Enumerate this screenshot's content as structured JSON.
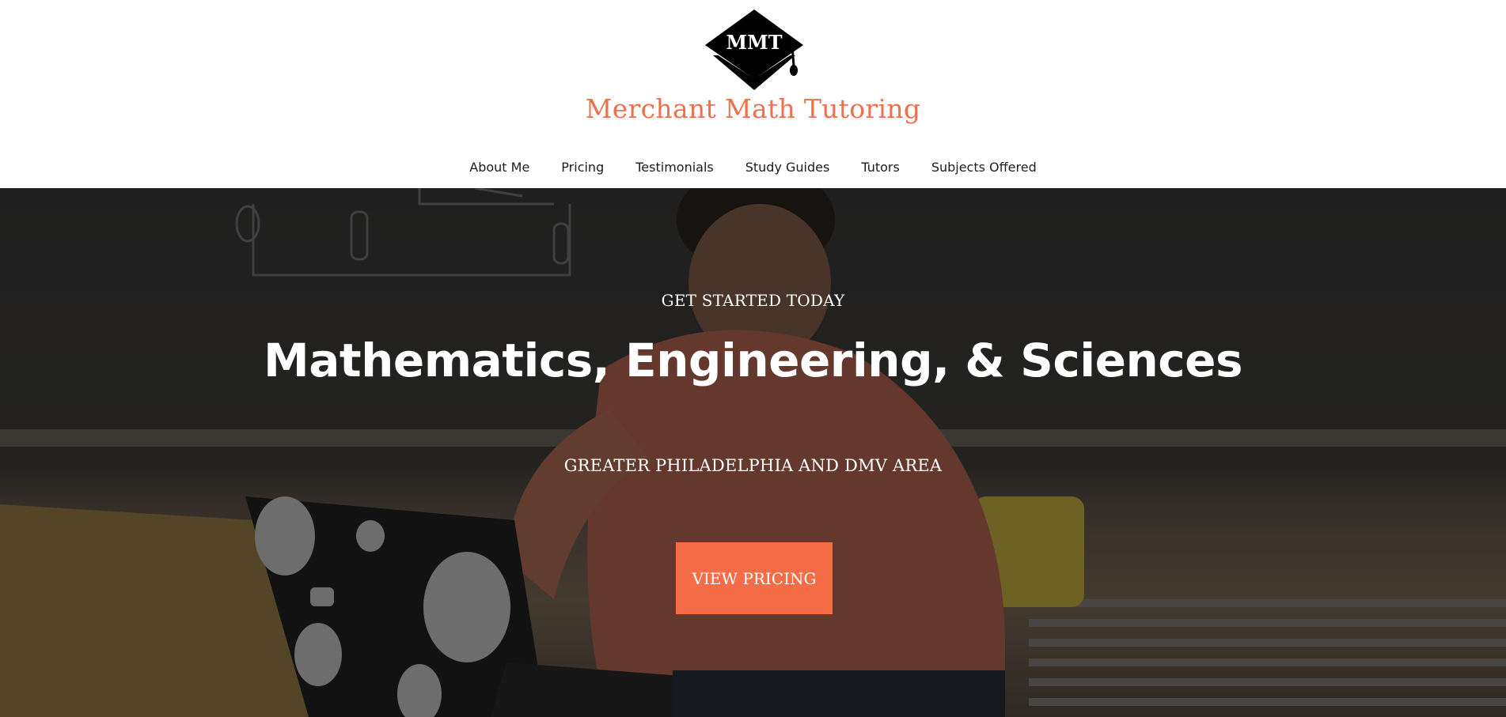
{
  "header": {
    "logo": {
      "text": "MMT",
      "icon": "graduation-cap-icon"
    },
    "title": "Merchant Math Tutoring"
  },
  "nav": {
    "items": [
      {
        "label": "About Me"
      },
      {
        "label": "Pricing"
      },
      {
        "label": "Testimonials"
      },
      {
        "label": "Study Guides"
      },
      {
        "label": "Tutors"
      },
      {
        "label": "Subjects Offered"
      }
    ]
  },
  "hero": {
    "eyebrow": "GET STARTED TODAY",
    "title": "Mathematics, Engineering, & Sciences",
    "subtitle": "GREATER PHILADELPHIA AND DMV AREA",
    "cta_label": "VIEW PRICING",
    "background_image": "student-at-laptop-photo"
  },
  "colors": {
    "accent": "#f46d46",
    "title": "#f0704c",
    "nav_text": "#1c1c1c",
    "hero_text": "#ffffff"
  }
}
